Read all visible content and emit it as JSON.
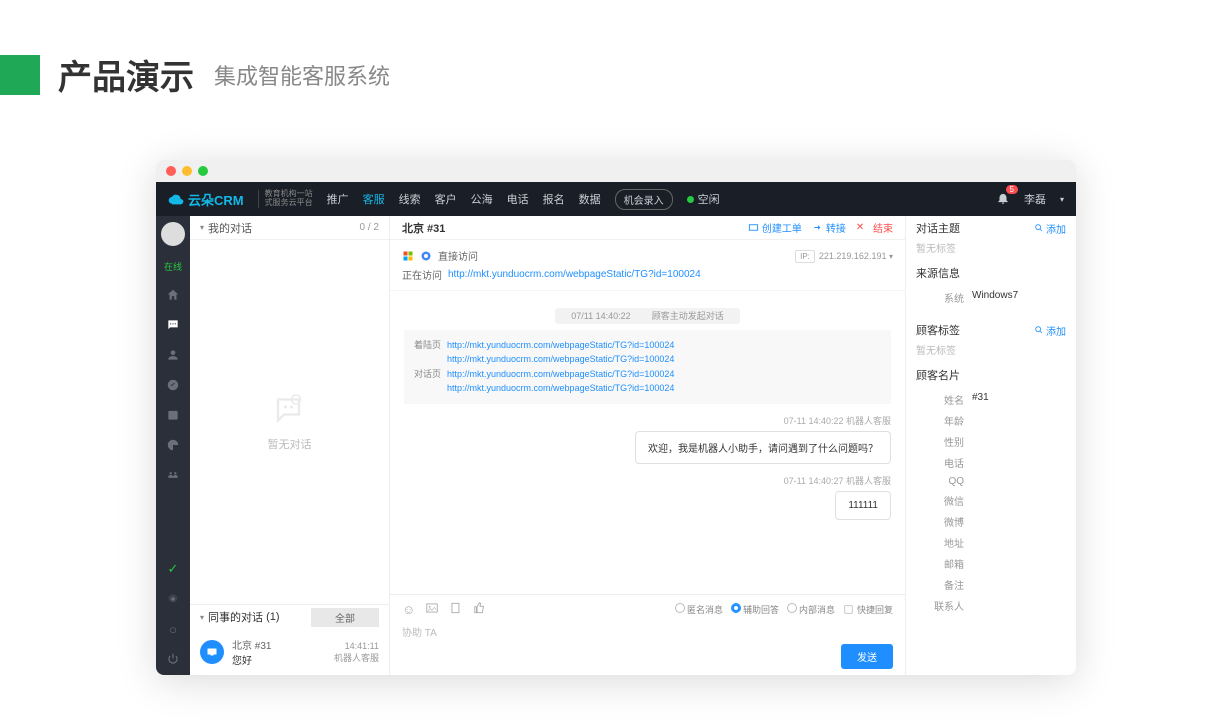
{
  "slide": {
    "title_main": "产品演示",
    "title_sub": "集成智能客服系统"
  },
  "topnav": {
    "logo": "云朵CRM",
    "logo_sub1": "教育机构一站",
    "logo_sub2": "式服务云平台",
    "items": [
      "推广",
      "客服",
      "线索",
      "客户",
      "公海",
      "电话",
      "报名",
      "数据"
    ],
    "btn": "机会录入",
    "status": "空闲",
    "notif_count": "5",
    "user": "李磊"
  },
  "rail": {
    "status": "在线"
  },
  "convos": {
    "my_header": "我的对话",
    "my_count": "0 / 2",
    "empty": "暂无对话",
    "col_header": "同事的对话",
    "col_count": "(1)",
    "col_tab": "全部",
    "item": {
      "name": "北京 #31",
      "msg": "您好",
      "time": "14:41:11",
      "src": "机器人客服"
    }
  },
  "chat": {
    "title": "北京 #31",
    "create_ticket": "创建工单",
    "transfer": "转接",
    "end": "结束",
    "direct_visit": "直接访问",
    "visiting_lbl": "正在访问",
    "visiting_url": "http://mkt.yunduocrm.com/webpageStatic/TG?id=100024",
    "ip_lbl": "IP:",
    "ip": "221.219.162.191",
    "sys_time": "07/11 14:40:22",
    "sys_text": "顾客主动发起对话",
    "landing_lbl": "着陆页",
    "dialog_lbl": "对话页",
    "url1": "http://mkt.yunduocrm.com/webpageStatic/TG?id=100024",
    "url2": "http://mkt.yunduocrm.com/webpageStatic/TG?id=100024",
    "url3": "http://mkt.yunduocrm.com/webpageStatic/TG?id=100024",
    "url4": "http://mkt.yunduocrm.com/webpageStatic/TG?id=100024",
    "msg1_time": "07-11 14:40:22  机器人客服",
    "msg1": "欢迎，我是机器人小助手，请问遇到了什么问题吗？",
    "msg2_time": "07-11 14:40:27  机器人客服",
    "msg2": "111111",
    "opt_anon": "匿名消息",
    "opt_assist": "辅助回答",
    "opt_internal": "内部消息",
    "opt_quick": "快捷回复",
    "placeholder": "协助 TA",
    "send": "发送"
  },
  "side": {
    "topic_hdr": "对话主题",
    "add": "添加",
    "no_tag": "暂无标签",
    "source_hdr": "来源信息",
    "sys_k": "系统",
    "sys_v": "Windows7",
    "tags_hdr": "顾客标签",
    "card_hdr": "顾客名片",
    "name_k": "姓名",
    "name_v": "#31",
    "age_k": "年龄",
    "sex_k": "性别",
    "phone_k": "电话",
    "qq_k": "QQ",
    "wechat_k": "微信",
    "weibo_k": "微博",
    "addr_k": "地址",
    "mail_k": "邮箱",
    "remark_k": "备注",
    "contact_k": "联系人"
  }
}
